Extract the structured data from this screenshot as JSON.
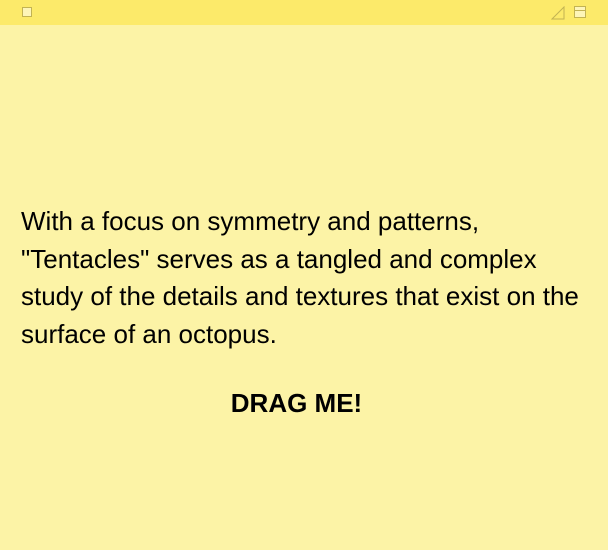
{
  "window": {
    "close_icon": "square-icon",
    "zoom_icon": "triangle-resize-icon",
    "collapse_icon": "collapse-box-icon"
  },
  "note": {
    "body_text": "With a focus on symmetry and patterns, \"Tentacles\" serves as a tangled and complex study of the details and textures that exist on the surface of an octopus.",
    "drag_label": "DRAG ME!"
  },
  "colors": {
    "note_background": "#fcf3a6",
    "titlebar_background": "#fcea6a",
    "icon_stroke": "#c2b353"
  }
}
